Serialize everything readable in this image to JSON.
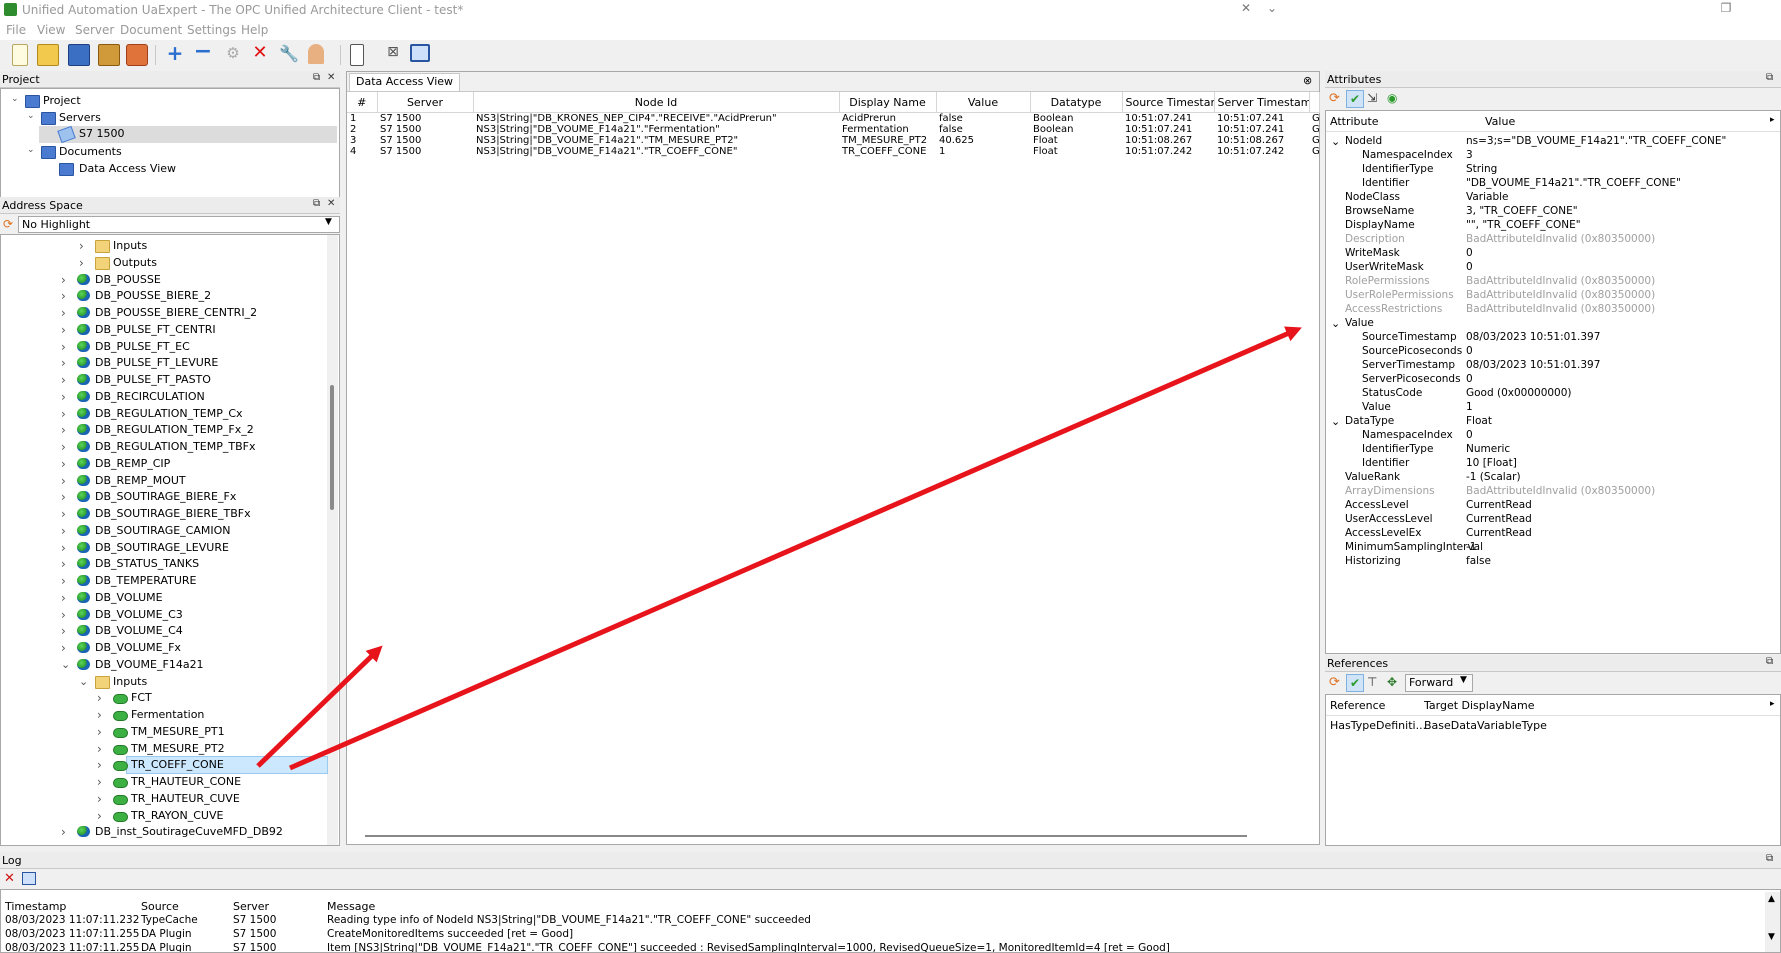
{
  "window": {
    "title": "Unified Automation UaExpert - The OPC Unified Architecture Client - test*"
  },
  "menu": [
    "File",
    "View",
    "Server",
    "Document",
    "Settings",
    "Help"
  ],
  "project": {
    "header": "Project",
    "items": [
      {
        "label": "Project"
      },
      {
        "label": "Servers"
      },
      {
        "label": "S7 1500"
      },
      {
        "label": "Documents"
      },
      {
        "label": "Data Access View"
      }
    ]
  },
  "address_space": {
    "header": "Address Space",
    "highlight": "No Highlight",
    "items": [
      {
        "label": "Inputs"
      },
      {
        "label": "Outputs"
      },
      {
        "label": "DB_POUSSE"
      },
      {
        "label": "DB_POUSSE_BIERE_2"
      },
      {
        "label": "DB_POUSSE_BIERE_CENTRI_2"
      },
      {
        "label": "DB_PULSE_FT_CENTRI"
      },
      {
        "label": "DB_PULSE_FT_EC"
      },
      {
        "label": "DB_PULSE_FT_LEVURE"
      },
      {
        "label": "DB_PULSE_FT_PASTO"
      },
      {
        "label": "DB_RECIRCULATION"
      },
      {
        "label": "DB_REGULATION_TEMP_Cx"
      },
      {
        "label": "DB_REGULATION_TEMP_Fx_2"
      },
      {
        "label": "DB_REGULATION_TEMP_TBFx"
      },
      {
        "label": "DB_REMP_CIP"
      },
      {
        "label": "DB_REMP_MOUT"
      },
      {
        "label": "DB_SOUTIRAGE_BIERE_Fx"
      },
      {
        "label": "DB_SOUTIRAGE_BIERE_TBFx"
      },
      {
        "label": "DB_SOUTIRAGE_CAMION"
      },
      {
        "label": "DB_SOUTIRAGE_LEVURE"
      },
      {
        "label": "DB_STATUS_TANKS"
      },
      {
        "label": "DB_TEMPERATURE"
      },
      {
        "label": "DB_VOLUME"
      },
      {
        "label": "DB_VOLUME_C3"
      },
      {
        "label": "DB_VOLUME_C4"
      },
      {
        "label": "DB_VOLUME_Fx"
      },
      {
        "label": "DB_VOUME_F14a21"
      },
      {
        "label": "Inputs"
      },
      {
        "label": "FCT"
      },
      {
        "label": "Fermentation"
      },
      {
        "label": "TM_MESURE_PT1"
      },
      {
        "label": "TM_MESURE_PT2"
      },
      {
        "label": "TR_COEFF_CONE"
      },
      {
        "label": "TR_HAUTEUR_CONE"
      },
      {
        "label": "TR_HAUTEUR_CUVE"
      },
      {
        "label": "TR_RAYON_CUVE"
      },
      {
        "label": "DB_inst_SoutirageCuveMFD_DB92"
      }
    ]
  },
  "dav": {
    "tab": "Data Access View",
    "columns": [
      "#",
      "Server",
      "Node Id",
      "Display Name",
      "Value",
      "Datatype",
      "Source Timestamp",
      "Server Timestamp"
    ],
    "rows": [
      {
        "n": "1",
        "server": "S7 1500",
        "node": "NS3|String|\"DB_KRONES_NEP_CIP4\".\"RECEIVE\".\"AcidPrerun\"",
        "name": "AcidPrerun",
        "value": "false",
        "type": "Boolean",
        "src": "10:51:07.241",
        "srv": "10:51:07.241",
        "extra": "G"
      },
      {
        "n": "2",
        "server": "S7 1500",
        "node": "NS3|String|\"DB_VOUME_F14a21\".\"Fermentation\"",
        "name": "Fermentation",
        "value": "false",
        "type": "Boolean",
        "src": "10:51:07.241",
        "srv": "10:51:07.241",
        "extra": "G"
      },
      {
        "n": "3",
        "server": "S7 1500",
        "node": "NS3|String|\"DB_VOUME_F14a21\".\"TM_MESURE_PT2\"",
        "name": "TM_MESURE_PT2",
        "value": "40.625",
        "type": "Float",
        "src": "10:51:08.267",
        "srv": "10:51:08.267",
        "extra": "G"
      },
      {
        "n": "4",
        "server": "S7 1500",
        "node": "NS3|String|\"DB_VOUME_F14a21\".\"TR_COEFF_CONE\"",
        "name": "TR_COEFF_CONE",
        "value": "1",
        "type": "Float",
        "src": "10:51:07.242",
        "srv": "10:51:07.242",
        "extra": "G"
      }
    ]
  },
  "attributes": {
    "header": "Attributes",
    "col_attr": "Attribute",
    "col_value": "Value",
    "rows": [
      {
        "name": "NodeId",
        "value": "ns=3;s=\"DB_VOUME_F14a21\".\"TR_COEFF_CONE\"",
        "level": 0,
        "expander": "v",
        "grey": false
      },
      {
        "name": "NamespaceIndex",
        "value": "3",
        "level": 1,
        "expander": "",
        "grey": false
      },
      {
        "name": "IdentifierType",
        "value": "String",
        "level": 1,
        "expander": "",
        "grey": false
      },
      {
        "name": "Identifier",
        "value": "\"DB_VOUME_F14a21\".\"TR_COEFF_CONE\"",
        "level": 1,
        "expander": "",
        "grey": false
      },
      {
        "name": "NodeClass",
        "value": "Variable",
        "level": 0,
        "expander": "",
        "grey": false
      },
      {
        "name": "BrowseName",
        "value": "3, \"TR_COEFF_CONE\"",
        "level": 0,
        "expander": "",
        "grey": false
      },
      {
        "name": "DisplayName",
        "value": "\"\", \"TR_COEFF_CONE\"",
        "level": 0,
        "expander": "",
        "grey": false
      },
      {
        "name": "Description",
        "value": "BadAttributeIdInvalid (0x80350000)",
        "level": 0,
        "expander": "",
        "grey": true
      },
      {
        "name": "WriteMask",
        "value": "0",
        "level": 0,
        "expander": "",
        "grey": false
      },
      {
        "name": "UserWriteMask",
        "value": "0",
        "level": 0,
        "expander": "",
        "grey": false
      },
      {
        "name": "RolePermissions",
        "value": "BadAttributeIdInvalid (0x80350000)",
        "level": 0,
        "expander": "",
        "grey": true
      },
      {
        "name": "UserRolePermissions",
        "value": "BadAttributeIdInvalid (0x80350000)",
        "level": 0,
        "expander": "",
        "grey": true
      },
      {
        "name": "AccessRestrictions",
        "value": "BadAttributeIdInvalid (0x80350000)",
        "level": 0,
        "expander": "",
        "grey": true
      },
      {
        "name": "Value",
        "value": "",
        "level": 0,
        "expander": "v",
        "grey": false
      },
      {
        "name": "SourceTimestamp",
        "value": "08/03/2023 10:51:01.397",
        "level": 1,
        "expander": "",
        "grey": false
      },
      {
        "name": "SourcePicoseconds",
        "value": "0",
        "level": 1,
        "expander": "",
        "grey": false
      },
      {
        "name": "ServerTimestamp",
        "value": "08/03/2023 10:51:01.397",
        "level": 1,
        "expander": "",
        "grey": false
      },
      {
        "name": "ServerPicoseconds",
        "value": "0",
        "level": 1,
        "expander": "",
        "grey": false
      },
      {
        "name": "StatusCode",
        "value": "Good (0x00000000)",
        "level": 1,
        "expander": "",
        "grey": false
      },
      {
        "name": "Value",
        "value": "1",
        "level": 1,
        "expander": "",
        "grey": false
      },
      {
        "name": "DataType",
        "value": "Float",
        "level": 0,
        "expander": "v",
        "grey": false
      },
      {
        "name": "NamespaceIndex",
        "value": "0",
        "level": 1,
        "expander": "",
        "grey": false
      },
      {
        "name": "IdentifierType",
        "value": "Numeric",
        "level": 1,
        "expander": "",
        "grey": false
      },
      {
        "name": "Identifier",
        "value": "10 [Float]",
        "level": 1,
        "expander": "",
        "grey": false
      },
      {
        "name": "ValueRank",
        "value": "-1 (Scalar)",
        "level": 0,
        "expander": "",
        "grey": false
      },
      {
        "name": "ArrayDimensions",
        "value": "BadAttributeIdInvalid (0x80350000)",
        "level": 0,
        "expander": "",
        "grey": true
      },
      {
        "name": "AccessLevel",
        "value": "CurrentRead",
        "level": 0,
        "expander": "",
        "grey": false
      },
      {
        "name": "UserAccessLevel",
        "value": "CurrentRead",
        "level": 0,
        "expander": "",
        "grey": false
      },
      {
        "name": "AccessLevelEx",
        "value": "CurrentRead",
        "level": 0,
        "expander": "",
        "grey": false
      },
      {
        "name": "MinimumSamplingInterval",
        "value": "-1",
        "level": 0,
        "expander": "",
        "grey": false
      },
      {
        "name": "Historizing",
        "value": "false",
        "level": 0,
        "expander": "",
        "grey": false
      }
    ]
  },
  "references": {
    "header": "References",
    "direction": "Forward",
    "col_ref": "Reference",
    "col_target": "Target DisplayName",
    "rows": [
      {
        "ref": "HasTypeDefiniti...",
        "target": "BaseDataVariableType"
      }
    ]
  },
  "log": {
    "header": "Log",
    "columns": [
      "Timestamp",
      "Source",
      "Server",
      "Message"
    ],
    "rows": [
      {
        "ts": "08/03/2023 11:07:11.232",
        "source": "TypeCache",
        "server": "S7 1500",
        "msg": "Reading type info of NodeId NS3|String|\"DB_VOUME_F14a21\".\"TR_COEFF_CONE\" succeeded"
      },
      {
        "ts": "08/03/2023 11:07:11.255",
        "source": "DA Plugin",
        "server": "S7 1500",
        "msg": "CreateMonitoredItems succeeded [ret = Good]"
      },
      {
        "ts": "08/03/2023 11:07:11.255",
        "source": "DA Plugin",
        "server": "S7 1500",
        "msg": "Item [NS3|String|\"DB_VOUME_F14a21\".\"TR_COEFF_CONE\"] succeeded : RevisedSamplingInterval=1000, RevisedQueueSize=1, MonitoredItemId=4 [ret = Good]"
      }
    ]
  },
  "colors": {
    "selection": "#cce8ff",
    "arrow": "#e8141c",
    "grey_text": "#a0a0a0"
  }
}
